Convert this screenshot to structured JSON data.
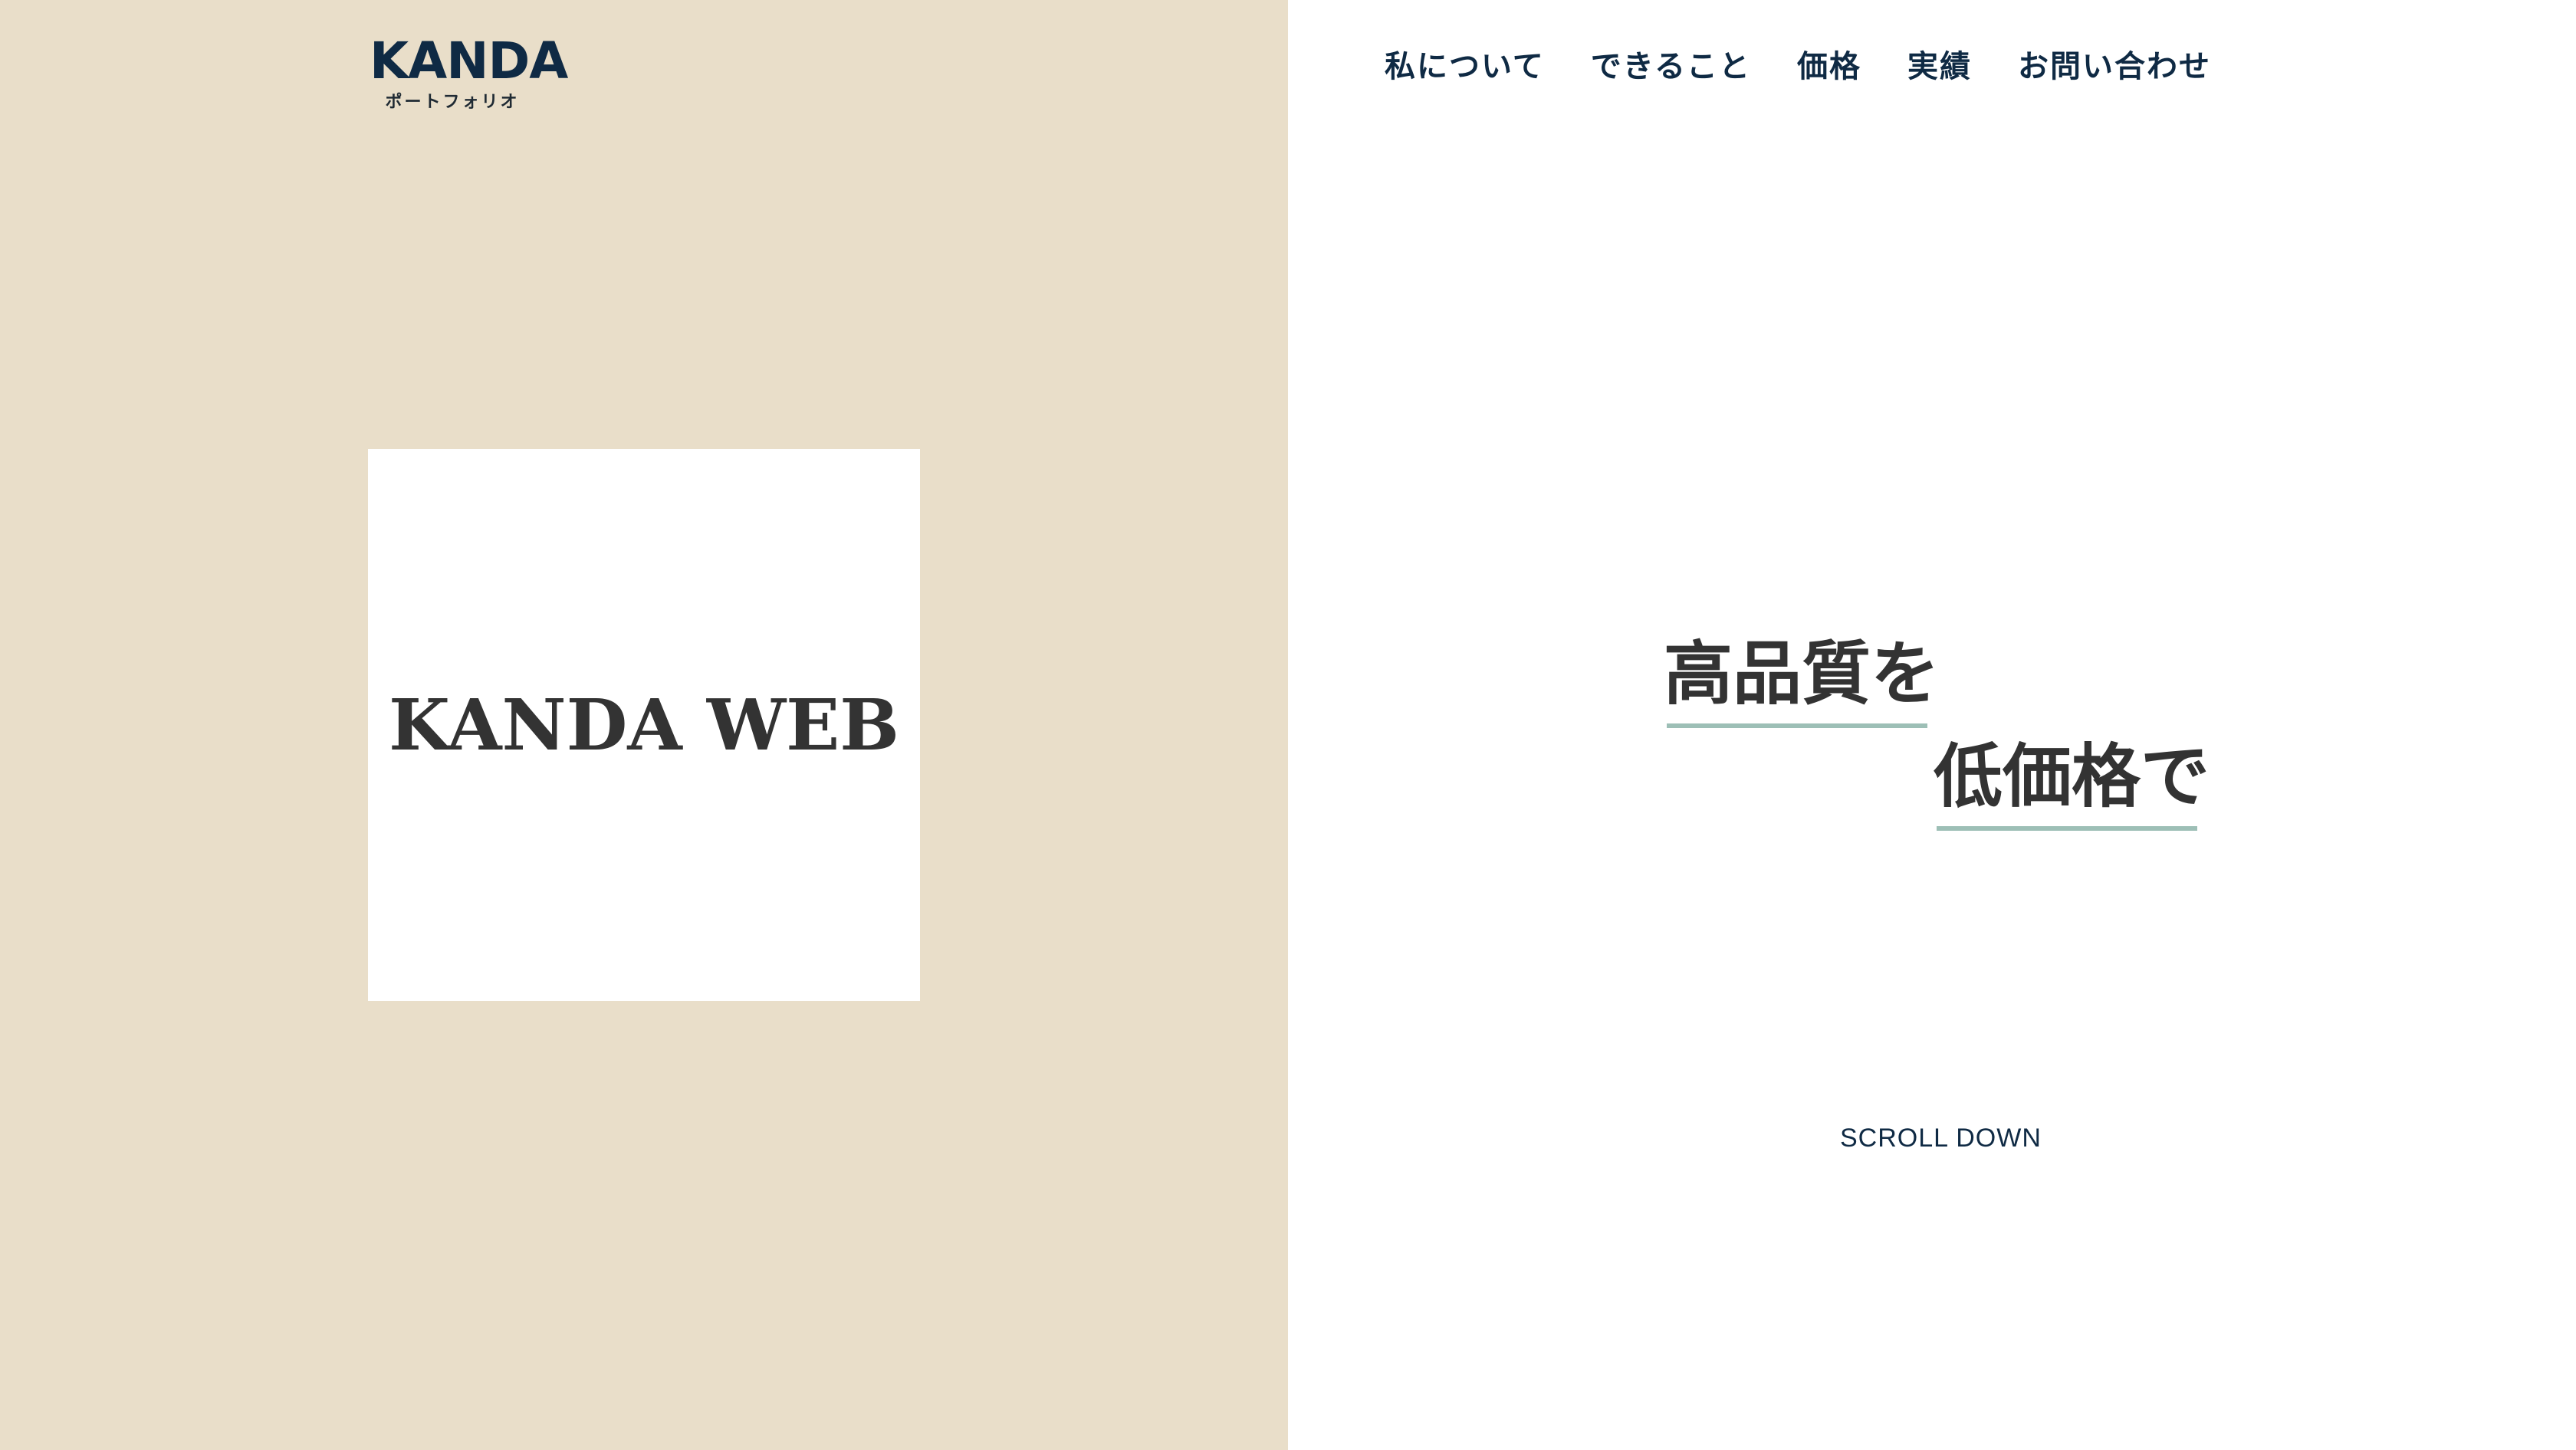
{
  "header": {
    "logo_main": "KANDA",
    "logo_sub": "ポートフォリオ",
    "nav": [
      {
        "label": "私について"
      },
      {
        "label": "できること"
      },
      {
        "label": "価格"
      },
      {
        "label": "実績"
      },
      {
        "label": "お問い合わせ"
      }
    ]
  },
  "hero": {
    "card_title": "KANDA WEB",
    "catch_line1": "高品質を",
    "catch_line2": "低価格で",
    "scroll_label": "SCROLL DOWN"
  },
  "colors": {
    "left_panel_bg": "#e9dec9",
    "right_panel_bg": "#ffffff",
    "navy": "#0f2a44",
    "text_dark": "#333333",
    "underline": "#9dbfb6"
  }
}
